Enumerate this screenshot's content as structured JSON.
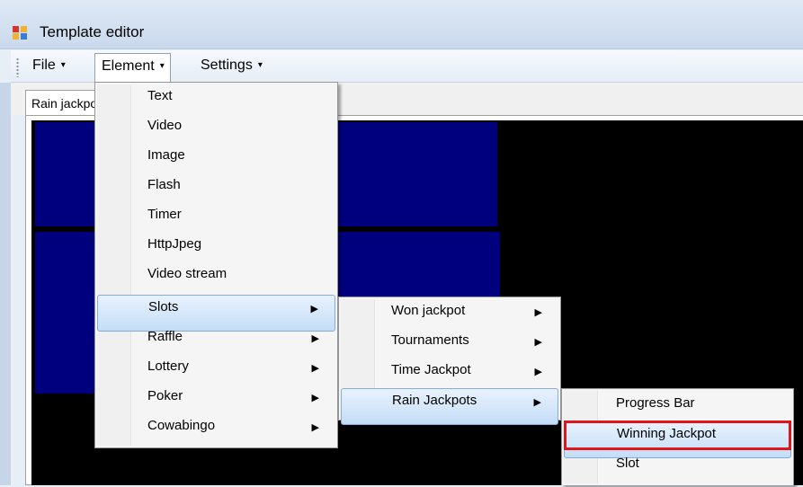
{
  "window": {
    "title": "Template editor",
    "icon": "app-window-icon"
  },
  "menubar": {
    "menus": [
      {
        "label": "File"
      },
      {
        "label": "Element"
      },
      {
        "label": "Settings"
      }
    ],
    "arrow": "▾"
  },
  "tabs": [
    {
      "label": "Rain jackpot",
      "selected": true
    }
  ],
  "colors": {
    "block_fill": "#00007f",
    "canvas_bg": "#000000",
    "highlight": "#c4ddf7",
    "focus_outline": "#e0151a"
  },
  "element_menu": {
    "items": [
      {
        "label": "Text",
        "submenu": false
      },
      {
        "label": "Video",
        "submenu": false
      },
      {
        "label": "Image",
        "submenu": false
      },
      {
        "label": "Flash",
        "submenu": false
      },
      {
        "label": "Timer",
        "submenu": false
      },
      {
        "label": "HttpJpeg",
        "submenu": false
      },
      {
        "label": "Video stream",
        "submenu": false
      },
      {
        "label": "Slots",
        "submenu": true,
        "highlighted": true
      },
      {
        "label": "Raffle",
        "submenu": true
      },
      {
        "label": "Lottery",
        "submenu": true
      },
      {
        "label": "Poker",
        "submenu": true
      },
      {
        "label": "Cowabingo",
        "submenu": true
      }
    ]
  },
  "slots_menu": {
    "items": [
      {
        "label": "Won jackpot",
        "submenu": true
      },
      {
        "label": "Tournaments",
        "submenu": true
      },
      {
        "label": "Time Jackpot",
        "submenu": true
      },
      {
        "label": "Rain Jackpots",
        "submenu": true,
        "highlighted": true
      }
    ]
  },
  "rain_jackpots_menu": {
    "items": [
      {
        "label": "Progress Bar"
      },
      {
        "label": "Winning Jackpot",
        "highlighted": true
      },
      {
        "label": "Slot"
      }
    ]
  },
  "submenu_arrow": "▶"
}
